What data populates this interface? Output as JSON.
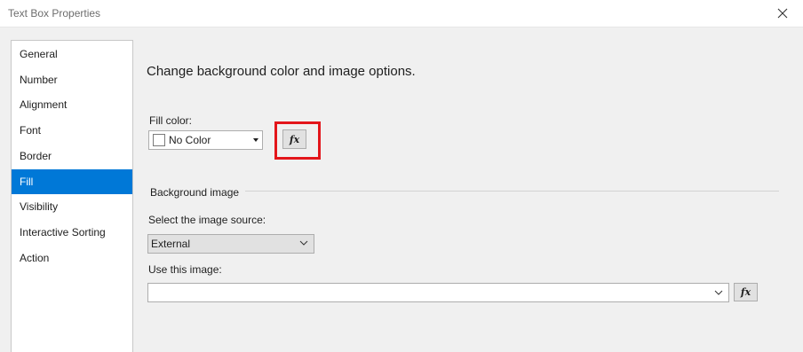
{
  "window": {
    "title": "Text Box Properties",
    "close_icon": "close-icon"
  },
  "sidebar": {
    "items": [
      {
        "label": "General"
      },
      {
        "label": "Number"
      },
      {
        "label": "Alignment"
      },
      {
        "label": "Font"
      },
      {
        "label": "Border"
      },
      {
        "label": "Fill",
        "selected": true
      },
      {
        "label": "Visibility"
      },
      {
        "label": "Interactive Sorting"
      },
      {
        "label": "Action"
      }
    ]
  },
  "main": {
    "heading": "Change background color and image options.",
    "fill": {
      "label": "Fill color:",
      "value": "No Color",
      "swatch_color": "#ffffff",
      "expression_button": "fx"
    },
    "background_image": {
      "group_label": "Background image",
      "source_label": "Select the image source:",
      "source_value": "External",
      "image_label": "Use this image:",
      "image_value": "",
      "expression_button": "fx"
    }
  },
  "colors": {
    "accent": "#0078d7",
    "highlight_border": "#e3151a",
    "panel_background": "#f0f0f0"
  }
}
